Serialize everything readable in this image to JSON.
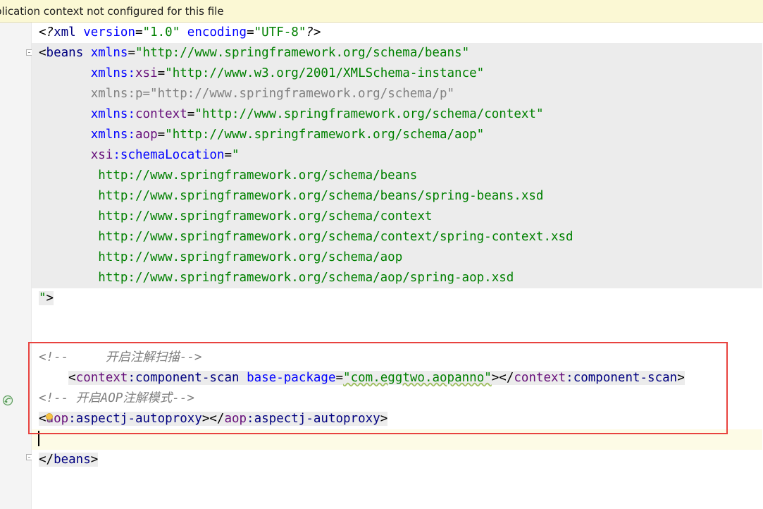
{
  "banner": {
    "text": "plication context not configured for this file"
  },
  "colors": {
    "banner_bg": "#fbf8d4",
    "editor_bg": "#ffffff",
    "gutter_bg": "#f4f4f4",
    "tag_gray_bg": "#ececec",
    "tag_name": "#000080",
    "namespace": "#660e7a",
    "attribute": "#0000ff",
    "string": "#008000",
    "comment": "#808080",
    "highlight_box": "#e8433f"
  },
  "icons": {
    "fold": "fold-marker-icon",
    "bean": "spring-bean-icon",
    "bulb": "intention-bulb-icon"
  },
  "code": {
    "l1": {
      "a": "<?",
      "b": "xml ",
      "c": "version",
      "d": "=",
      "e": "\"1.0\"",
      "f": " ",
      "g": "encoding",
      "h": "=",
      "i": "\"UTF-8\"",
      "j": "?>"
    },
    "l2": {
      "a": "<",
      "b": "beans ",
      "c": "xmlns",
      "d": "=",
      "e": "\"http://www.springframework.org/schema/beans\""
    },
    "l3": {
      "indent": "       ",
      "ns": "xmlns",
      "colon": ":",
      "attr": "xsi",
      "eq": "=",
      "val": "\"http://www.w3.org/2001/XMLSchema-instance\""
    },
    "l4": {
      "indent": "       ",
      "text": "xmlns:p=\"http://www.springframework.org/schema/p\""
    },
    "l5": {
      "indent": "       ",
      "ns": "xmlns",
      "colon": ":",
      "attr": "context",
      "eq": "=",
      "val": "\"http://www.springframework.org/schema/context\""
    },
    "l6": {
      "indent": "       ",
      "ns": "xmlns",
      "colon": ":",
      "attr": "aop",
      "eq": "=",
      "val": "\"http://www.springframework.org/schema/aop\""
    },
    "l7": {
      "indent": "       ",
      "ns": "xsi",
      "colon": ":",
      "attr": "schemaLocation",
      "eq": "=",
      "val": "\""
    },
    "l8": "        http://www.springframework.org/schema/beans",
    "l9": "        http://www.springframework.org/schema/beans/spring-beans.xsd",
    "l10": "        http://www.springframework.org/schema/context",
    "l11": "        http://www.springframework.org/schema/context/spring-context.xsd",
    "l12": "        http://www.springframework.org/schema/aop",
    "l13": "        http://www.springframework.org/schema/aop/spring-aop.xsd",
    "l14": {
      "a": "\"",
      "b": ">"
    },
    "l15": "",
    "l16": "<!--     开启注解扫描-->",
    "l17": {
      "indent": "    ",
      "a": "<",
      "ns": "context",
      "colon": ":",
      "tag": "component-scan ",
      "attr": "base-package",
      "eq": "=",
      "val": "\"com.eggtwo.aopanno\"",
      "close1": "></",
      "ns2": "context",
      "colon2": ":",
      "tag2": "component-scan",
      "close2": ">"
    },
    "l18": "<!-- 开启AOP注解模式-->",
    "l19": {
      "a": "<",
      "ns": "aop",
      "colon": ":",
      "tag": "aspectj-autoproxy",
      "close1": "></",
      "ns2": "aop",
      "colon2": ":",
      "tag2": "aspectj-autoproxy",
      "close2": ">"
    },
    "l20": "",
    "l21": {
      "a": "</",
      "b": "beans",
      "c": ">"
    }
  }
}
